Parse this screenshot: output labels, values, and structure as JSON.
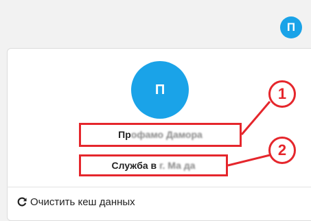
{
  "header": {
    "avatar_letter": "П"
  },
  "profile": {
    "avatar_letter": "П",
    "name_visible": "Пр",
    "name_obscured": "офамо Дамора",
    "department_visible": "Служба в",
    "department_obscured": "г. Ма да"
  },
  "annotations": {
    "callout_1": "1",
    "callout_2": "2"
  },
  "footer": {
    "clear_cache_label": "Очистить кеш данных",
    "clear_cache_icon": "refresh-icon"
  },
  "colors": {
    "accent": "#1aa3e8",
    "annotation": "#e5262c"
  }
}
